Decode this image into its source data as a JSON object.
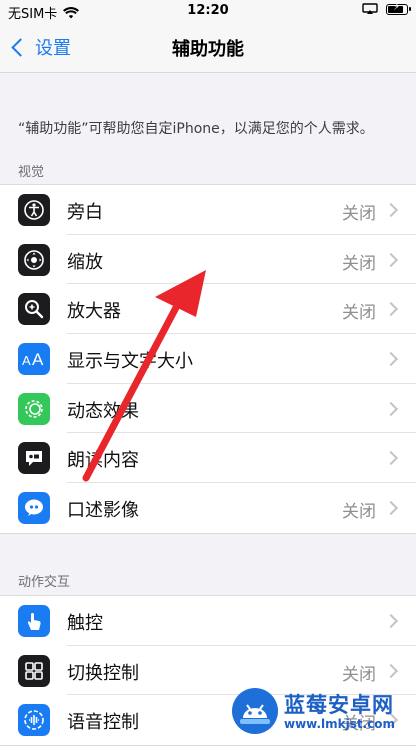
{
  "status_bar": {
    "carrier": "无SIM卡",
    "time": "12:20",
    "battery_level": 0.9
  },
  "nav": {
    "back_label": "设置",
    "title": "辅助功能"
  },
  "intro_text": "“辅助功能”可帮助您自定iPhone，以满足您的个人需求。",
  "sections": [
    {
      "header": "视觉",
      "items": [
        {
          "label": "旁白",
          "value": "关闭",
          "icon": "voiceover-icon",
          "icon_bg": "#1c1c1e"
        },
        {
          "label": "缩放",
          "value": "关闭",
          "icon": "zoom-icon",
          "icon_bg": "#1c1c1e"
        },
        {
          "label": "放大器",
          "value": "关闭",
          "icon": "magnifier-icon",
          "icon_bg": "#1c1c1e"
        },
        {
          "label": "显示与文字大小",
          "value": "",
          "icon": "text-size-icon",
          "icon_bg": "#1a7cf3"
        },
        {
          "label": "动态效果",
          "value": "",
          "icon": "motion-icon",
          "icon_bg": "#34c759"
        },
        {
          "label": "朗读内容",
          "value": "",
          "icon": "spoken-content-icon",
          "icon_bg": "#1c1c1e"
        },
        {
          "label": "口述影像",
          "value": "关闭",
          "icon": "audio-description-icon",
          "icon_bg": "#1a7cf3"
        }
      ]
    },
    {
      "header": "动作交互",
      "items": [
        {
          "label": "触控",
          "value": "",
          "icon": "touch-icon",
          "icon_bg": "#1a7cf3"
        },
        {
          "label": "切换控制",
          "value": "关闭",
          "icon": "switch-control-icon",
          "icon_bg": "#1c1c1e"
        },
        {
          "label": "语音控制",
          "value": "关闭",
          "icon": "voice-control-icon",
          "icon_bg": "#1a7cf3"
        }
      ]
    }
  ],
  "watermark": {
    "title": "蓝莓安卓网",
    "url": "www.lmkjst.com"
  },
  "colors": {
    "accent": "#1a7cf3",
    "annotation_arrow": "#e8262b"
  }
}
